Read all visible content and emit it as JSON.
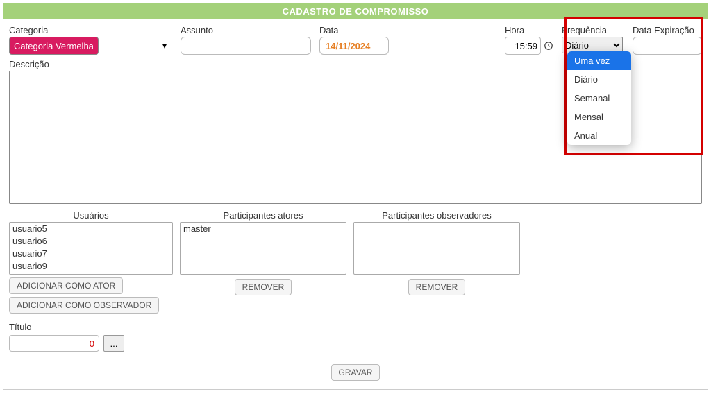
{
  "header": {
    "title": "CADASTRO DE COMPROMISSO"
  },
  "labels": {
    "categoria": "Categoria",
    "assunto": "Assunto",
    "data": "Data",
    "hora": "Hora",
    "frequencia": "Frequência",
    "data_exp": "Data Expiração",
    "descricao": "Descrição",
    "usuarios": "Usuários",
    "part_atores": "Participantes atores",
    "part_obs": "Participantes observadores",
    "titulo": "Título"
  },
  "values": {
    "categoria": "Categoria Vermelha",
    "data": "14/11/2024",
    "hora": "15:59",
    "frequencia": "Diário",
    "titulo": "0"
  },
  "dropdown": {
    "options": [
      "Uma vez",
      "Diário",
      "Semanal",
      "Mensal",
      "Anual"
    ],
    "selected_index": 0
  },
  "usuarios": [
    "usuario5",
    "usuario6",
    "usuario7",
    "usuario9"
  ],
  "atores": [
    "master"
  ],
  "observadores": [],
  "buttons": {
    "add_ator": "ADICIONAR COMO ATOR",
    "add_obs": "ADICIONAR COMO OBSERVADOR",
    "remover": "REMOVER",
    "gravar": "GRAVAR",
    "dots": "..."
  }
}
